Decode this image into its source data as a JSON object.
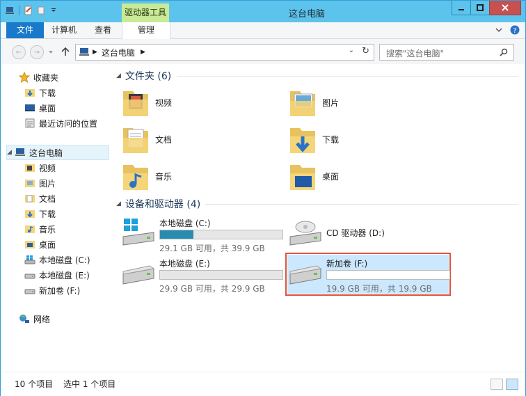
{
  "window": {
    "title": "这台电脑",
    "context_tab_group": "驱动器工具"
  },
  "ribbon": {
    "tabs": [
      "文件",
      "计算机",
      "查看",
      "管理"
    ]
  },
  "address": {
    "breadcrumb": "这台电脑",
    "search_placeholder": "搜索\"这台电脑\""
  },
  "sidebar": {
    "favorites": {
      "label": "收藏夹",
      "items": [
        "下载",
        "桌面",
        "最近访问的位置"
      ]
    },
    "computer": {
      "label": "这台电脑",
      "items": [
        "视频",
        "图片",
        "文档",
        "下载",
        "音乐",
        "桌面",
        "本地磁盘 (C:)",
        "本地磁盘 (E:)",
        "新加卷 (F:)"
      ]
    },
    "network": {
      "label": "网络"
    }
  },
  "folders": {
    "header": "文件夹 (6)",
    "items": [
      "视频",
      "图片",
      "文档",
      "下载",
      "音乐",
      "桌面"
    ]
  },
  "devices": {
    "header": "设备和驱动器 (4)",
    "drives": [
      {
        "name": "本地磁盘 (C:)",
        "free": "29.1 GB 可用，共 39.9 GB",
        "used_fraction": 0.27
      },
      {
        "name": "CD 驱动器 (D:)"
      },
      {
        "name": "本地磁盘 (E:)",
        "free": "29.9 GB 可用，共 29.9 GB",
        "used_fraction": 0.0
      },
      {
        "name": "新加卷 (F:)",
        "free": "19.9 GB 可用，共 19.9 GB",
        "used_fraction": 0.0
      }
    ]
  },
  "status": {
    "count": "10 个项目",
    "selected": "选中 1 个项目"
  },
  "colors": {
    "titlebar": "#5cc3ec",
    "file_tab": "#1979ca",
    "context_tab": "#c9ea96",
    "selection_outline": "#e0533c",
    "disk_fill": "#2a8bb0"
  }
}
